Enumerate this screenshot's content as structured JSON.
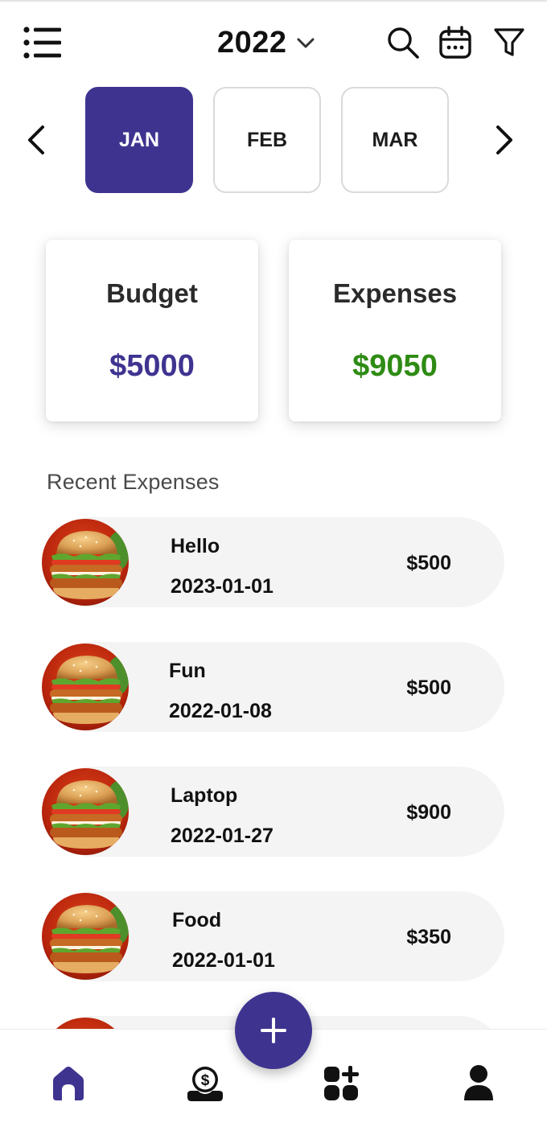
{
  "header": {
    "year": "2022",
    "icons": [
      "menu-icon",
      "chevron-down-icon",
      "search-icon",
      "calendar-icon",
      "filter-icon"
    ]
  },
  "months": {
    "items": [
      "JAN",
      "FEB",
      "MAR"
    ],
    "selected": "JAN"
  },
  "summary": {
    "budget_label": "Budget",
    "budget_value": "$5000",
    "expenses_label": "Expenses",
    "expenses_value": "$9050"
  },
  "section_title": "Recent Expenses",
  "expenses": [
    {
      "name": "Hello",
      "date": "2023-01-01",
      "amount": "$500",
      "icon": "burger-image"
    },
    {
      "name": "Fun",
      "date": "2022-01-08",
      "amount": "$500",
      "icon": "burger-image"
    },
    {
      "name": "Laptop",
      "date": "2022-01-27",
      "amount": "$900",
      "icon": "burger-image"
    },
    {
      "name": "Food",
      "date": "2022-01-01",
      "amount": "$350",
      "icon": "burger-image"
    }
  ],
  "nav": {
    "items": [
      "home-icon",
      "money-icon",
      "apps-add-icon",
      "profile-icon"
    ],
    "fab": "plus-icon"
  },
  "colors": {
    "primary": "#3e3490",
    "budget": "#3e3490",
    "expenses": "#2e8b14",
    "row_bg": "#f4f4f4"
  }
}
